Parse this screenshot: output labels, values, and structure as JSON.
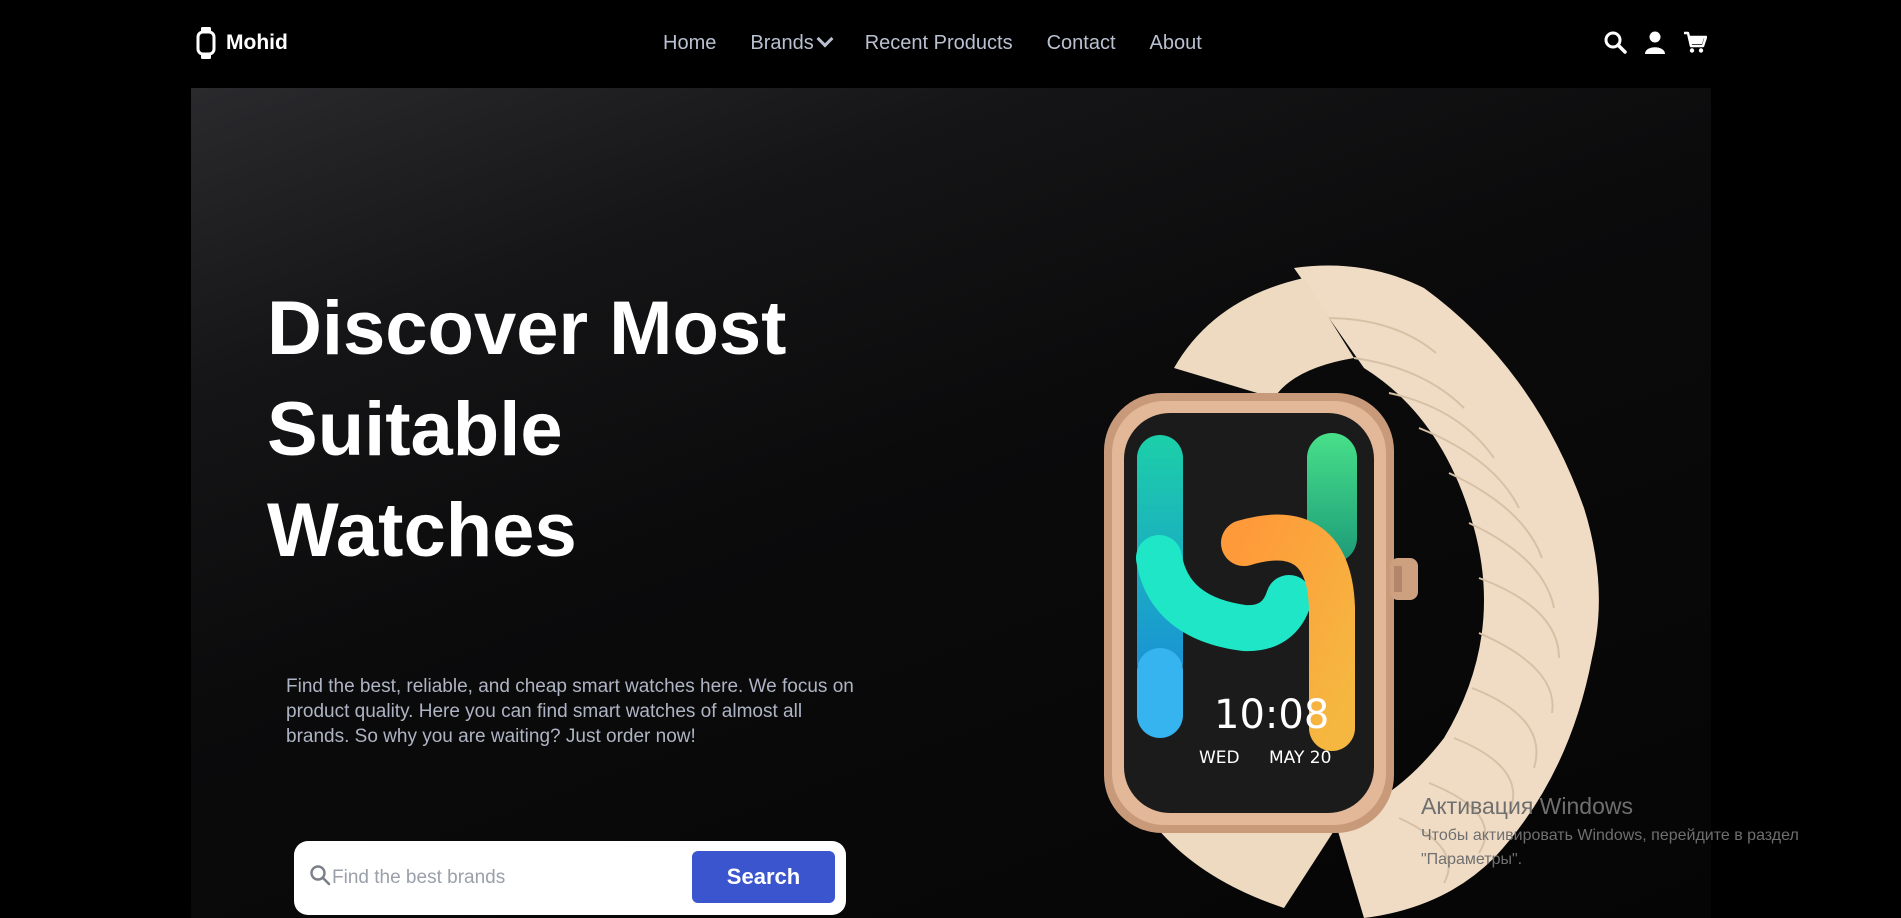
{
  "brand": {
    "name": "Mohid",
    "logo_icon": "watch-icon"
  },
  "nav": {
    "items": [
      {
        "label": "Home"
      },
      {
        "label": "Brands",
        "has_dropdown": true
      },
      {
        "label": "Recent Products"
      },
      {
        "label": "Contact"
      },
      {
        "label": "About"
      }
    ],
    "icons": [
      "search-icon",
      "user-icon",
      "cart-icon"
    ]
  },
  "hero": {
    "title_lines": [
      "Discover Most",
      "Suitable",
      "Watches"
    ],
    "description": "Find the best, reliable, and cheap smart watches here. We focus on product quality. Here you can find smart watches of almost all brands. So why you are waiting? Just order now!",
    "search": {
      "placeholder": "Find the best brands",
      "value": "",
      "button_label": "Search"
    },
    "watch": {
      "time": "10:08",
      "day": "WED",
      "date": "MAY 20"
    }
  },
  "overlay": {
    "activation_title": "Активация Windows",
    "activation_text": "Чтобы активировать Windows, перейдите в раздел \"Параметры\"."
  },
  "colors": {
    "background": "#000000",
    "accent": "#3b55cf",
    "nav_text": "#b9c0d0",
    "strap": "#f0dcc4"
  }
}
